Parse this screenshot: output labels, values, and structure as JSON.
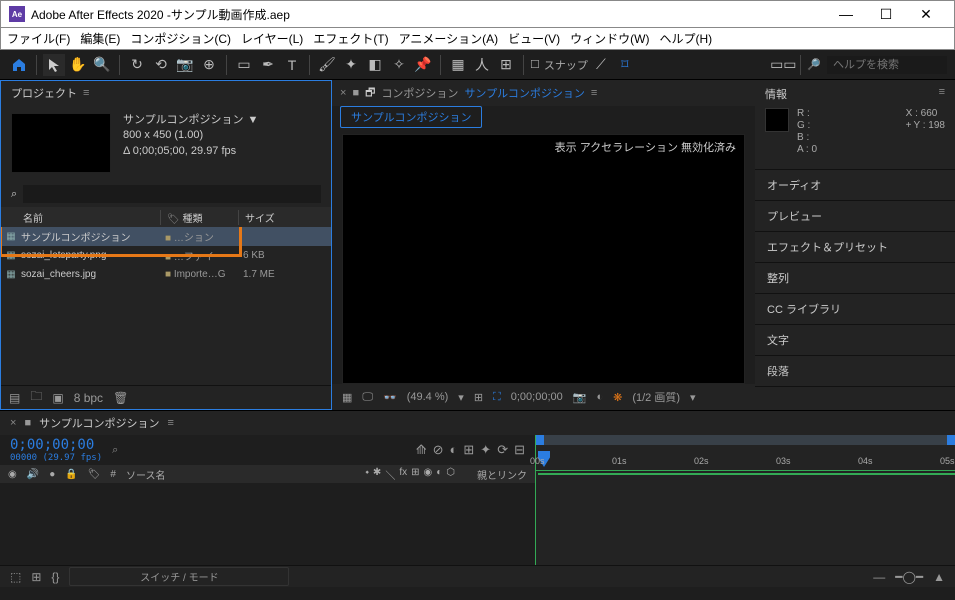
{
  "window": {
    "app": "Adobe After Effects 2020",
    "project": "サンプル動画作成.aep"
  },
  "menu": {
    "file": "ファイル(F)",
    "edit": "編集(E)",
    "comp": "コンポジション(C)",
    "layer": "レイヤー(L)",
    "effect": "エフェクト(T)",
    "anim": "アニメーション(A)",
    "view": "ビュー(V)",
    "window": "ウィンドウ(W)",
    "help": "ヘルプ(H)"
  },
  "toolbar": {
    "snap": "スナップ",
    "search_ph": "ヘルプを検索"
  },
  "project_panel": {
    "title": "プロジェクト",
    "comp_name": "サンプルコンポジション",
    "dims": "800 x 450 (1.00)",
    "dur": "Δ 0;00;05;00, 29.97 fps",
    "cols": {
      "name": "名前",
      "type": "種類",
      "size": "サイズ"
    },
    "rows": [
      {
        "icon": "▦",
        "name": "サンプルコンポジション",
        "type": "…ション",
        "size": "",
        "sel": true
      },
      {
        "icon": "▦",
        "name": "sozai_letsparty.png",
        "type": "…ファイ",
        "size": "6 KB",
        "sel": false
      },
      {
        "icon": "▦",
        "name": "sozai_cheers.jpg",
        "type": "Importe…G",
        "size": "1.7 ME",
        "sel": false
      }
    ],
    "bpc": "8 bpc"
  },
  "composition": {
    "label": "コンポジション",
    "name": "サンプルコンポジション",
    "tab": "サンプルコンポジション",
    "accel": "表示 アクセラレーション 無効化済み",
    "zoom": "(49.4 %)",
    "time": "0;00;00;00",
    "quality": "(1/2 画質)"
  },
  "info": {
    "title": "情報",
    "r": "R :",
    "g": "G :",
    "b": "B :",
    "a": "A : 0",
    "x": "X : 660",
    "y": "Y : 198"
  },
  "right_panels": {
    "audio": "オーディオ",
    "preview": "プレビュー",
    "effects": "エフェクト＆プリセット",
    "align": "整列",
    "cclib": "CC ライブラリ",
    "char": "文字",
    "para": "段落"
  },
  "timeline": {
    "tab": "サンプルコンポジション",
    "tc": "0;00;00;00",
    "fps": "00000 (29.97 fps)",
    "cols": {
      "src": "ソース名",
      "parent": "親とリンク"
    },
    "mode": "スイッチ / モード",
    "marks": [
      "00s",
      "01s",
      "02s",
      "03s",
      "04s",
      "05s"
    ]
  }
}
